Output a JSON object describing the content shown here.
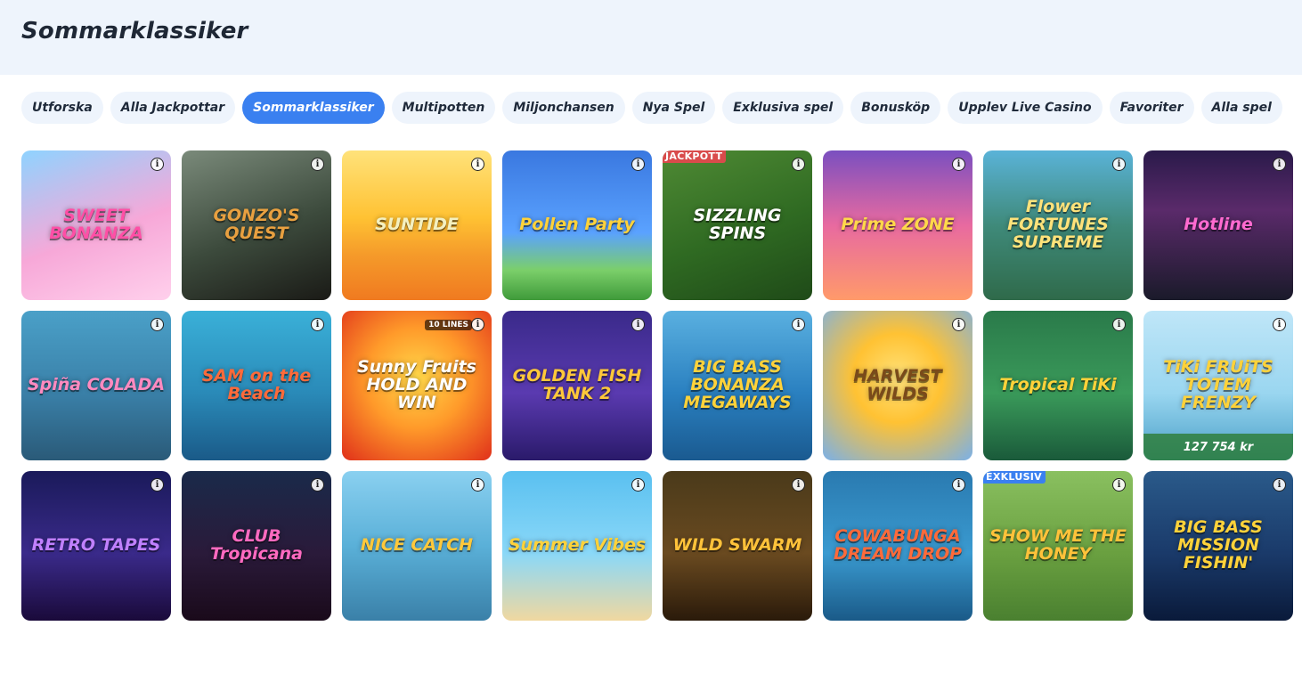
{
  "header": {
    "title": "Sommarklassiker"
  },
  "tabs": [
    {
      "label": "Utforska",
      "active": false
    },
    {
      "label": "Alla Jackpottar",
      "active": false
    },
    {
      "label": "Sommarklassiker",
      "active": true
    },
    {
      "label": "Multipotten",
      "active": false
    },
    {
      "label": "Miljonchansen",
      "active": false
    },
    {
      "label": "Nya Spel",
      "active": false
    },
    {
      "label": "Exklusiva spel",
      "active": false
    },
    {
      "label": "Bonusköp",
      "active": false
    },
    {
      "label": "Upplev Live Casino",
      "active": false
    },
    {
      "label": "Favoriter",
      "active": false
    },
    {
      "label": "Alla spel",
      "active": false
    }
  ],
  "games": [
    {
      "title": "SWEET BONANZA",
      "bg": "linear-gradient(160deg,#8fd3ff 0%,#f7a8d8 55%,#ffd0ec 100%)",
      "color": "#ff4fa6"
    },
    {
      "title": "GONZO'S QUEST",
      "bg": "linear-gradient(160deg,#7a8a7a 0%,#3c4a3c 55%,#1a1a16 100%)",
      "color": "#e8a040"
    },
    {
      "title": "SUNTIDE",
      "bg": "linear-gradient(180deg,#ffe27a 0%,#ffc233 45%,#f59a2a 70%,#f07a20 100%)",
      "color": "#f4f0c0"
    },
    {
      "title": "Pollen Party",
      "bg": "linear-gradient(180deg,#3a78e0 0%,#5aa2ff 55%,#7bcf6a 80%,#3f9a3a 100%)",
      "color": "#ffd23a"
    },
    {
      "title": "SIZZLING SPINS",
      "bg": "linear-gradient(160deg,#4f8a34 0%,#2f6a22 55%,#1f4a18 100%)",
      "color": "#ffffff",
      "badge": "JACKPOTT",
      "badgeType": "jackpot"
    },
    {
      "title": "Prime ZONE",
      "bg": "linear-gradient(180deg,#7a4fc0 0%,#e86aa0 50%,#ff9a6a 100%)",
      "color": "#ffd84a"
    },
    {
      "title": "Flower FORTUNES SUPREME",
      "bg": "linear-gradient(180deg,#5ab3d8 0%,#3f8a7a 50%,#2f6a4a 100%)",
      "color": "#ffe27a"
    },
    {
      "title": "Hotline",
      "bg": "linear-gradient(180deg,#2a1a4a 0%,#5a2a6a 40%,#1a1a2a 100%)",
      "color": "#ff6ad0"
    },
    {
      "title": "Spiña COLADA",
      "bg": "linear-gradient(180deg,#4aa0c8 0%,#3a80a8 55%,#2a5a78 100%)",
      "color": "#ff8ac0"
    },
    {
      "title": "SAM on the Beach",
      "bg": "linear-gradient(180deg,#3ab0d8 0%,#2a8ab8 55%,#1a5a88 100%)",
      "color": "#ff6a3a"
    },
    {
      "title": "Sunny Fruits HOLD AND WIN",
      "bg": "radial-gradient(circle at 50% 45%,#ffd84a 0%,#ff9a2a 45%,#e0301a 100%)",
      "color": "#ffffff",
      "lines": "10 LINES"
    },
    {
      "title": "GOLDEN FISH TANK 2",
      "bg": "linear-gradient(180deg,#3a2a8a 0%,#5a3ab0 55%,#2a1a6a 100%)",
      "color": "#ffc83a"
    },
    {
      "title": "BIG BASS BONANZA MEGAWAYS",
      "bg": "linear-gradient(180deg,#5ab0e0 0%,#2a80c0 55%,#1a5a90 100%)",
      "color": "#ffd23a"
    },
    {
      "title": "HARVEST WILDS",
      "bg": "radial-gradient(circle at 50% 45%,#ffe27a 0%,#ffc233 40%,#7ab0e8 100%)",
      "color": "#7a4a1a"
    },
    {
      "title": "Tropical TiKi",
      "bg": "linear-gradient(180deg,#2a7a4a 0%,#3a9a5a 55%,#1a5a3a 100%)",
      "color": "#ffd23a"
    },
    {
      "title": "TiKi FRUiTS TOTEM FRENZY",
      "bg": "linear-gradient(180deg,#bfe6f8 0%,#9ad6f0 55%,#4aa0c8 100%)",
      "color": "#ffd23a",
      "jackpot": "127 754 kr"
    },
    {
      "title": "RETRO TAPES",
      "bg": "linear-gradient(180deg,#1a1a5a 0%,#3a2a8a 55%,#1a0a3a 100%)",
      "color": "#c080ff"
    },
    {
      "title": "CLUB Tropicana",
      "bg": "linear-gradient(180deg,#1a2a4a 0%,#2a1a3a 55%,#1a0a1a 100%)",
      "color": "#ff6ac0"
    },
    {
      "title": "NICE CATCH",
      "bg": "linear-gradient(180deg,#8ad0f0 0%,#5ab0d8 50%,#3a80a8 100%)",
      "color": "#ffc83a"
    },
    {
      "title": "Summer Vibes",
      "bg": "linear-gradient(180deg,#5ac0f0 0%,#8ad8f8 55%,#f0d8a0 100%)",
      "color": "#ffd23a"
    },
    {
      "title": "WILD SWARM",
      "bg": "linear-gradient(180deg,#4a3a1a 0%,#6a4a20 55%,#2a1a0a 100%)",
      "color": "#ffc23a"
    },
    {
      "title": "COWABUNGA DREAM DROP",
      "bg": "linear-gradient(180deg,#2a7ab0 0%,#3a9ad0 55%,#1a5a88 100%)",
      "color": "#ff6a3a"
    },
    {
      "title": "SHOW ME THE HONEY",
      "bg": "linear-gradient(180deg,#8ac060 0%,#6aa040 55%,#4a8030 100%)",
      "color": "#ffc23a",
      "badge": "EXKLUSIV",
      "badgeType": "exclusive"
    },
    {
      "title": "BIG BASS MISSION FISHIN'",
      "bg": "linear-gradient(180deg,#2a5a8a 0%,#1a3a6a 55%,#0a1a3a 100%)",
      "color": "#ffd23a"
    }
  ]
}
